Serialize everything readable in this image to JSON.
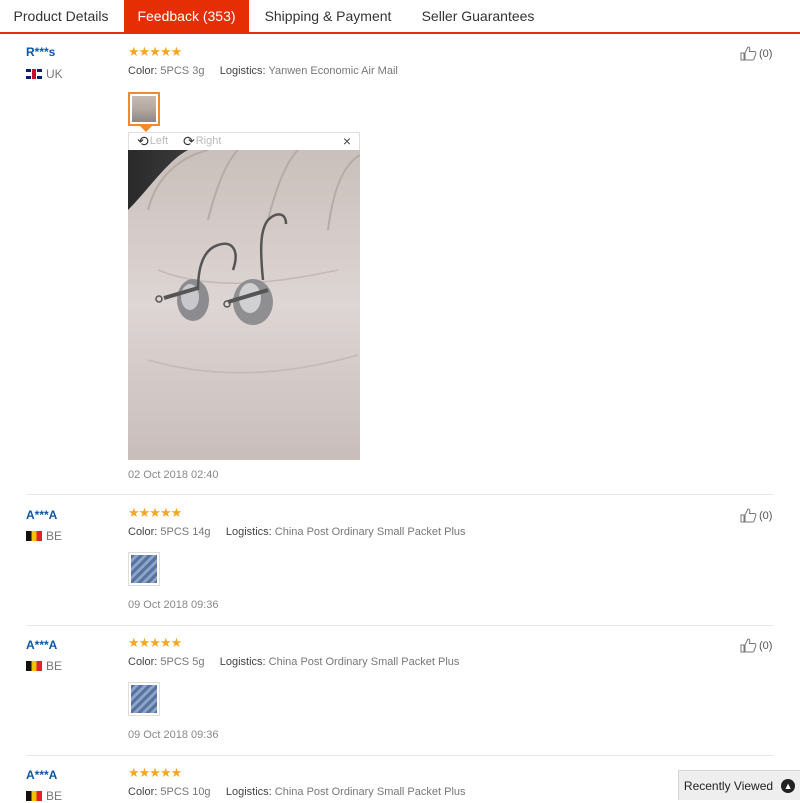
{
  "tabs": [
    {
      "label": "Product Details",
      "active": false
    },
    {
      "label": "Feedback (353)",
      "active": true
    },
    {
      "label": "Shipping & Payment",
      "active": false
    },
    {
      "label": "Seller Guarantees",
      "active": false
    }
  ],
  "reviews": [
    {
      "user": "R***s",
      "country": "UK",
      "flag": "uk-flag-icon",
      "rating": 5,
      "color_label": "Color:",
      "color_value": "5PCS 3g",
      "logistics_label": "Logistics:",
      "logistics_value": "Yanwen Economic Air Mail",
      "likes": "(0)",
      "date": "02 Oct 2018 02:40"
    },
    {
      "user": "A***A",
      "country": "BE",
      "flag": "be-flag-icon",
      "rating": 5,
      "color_label": "Color:",
      "color_value": "5PCS 14g",
      "logistics_label": "Logistics:",
      "logistics_value": "China Post Ordinary Small Packet Plus",
      "likes": "(0)",
      "date": "09 Oct 2018 09:36"
    },
    {
      "user": "A***A",
      "country": "BE",
      "flag": "be-flag-icon",
      "rating": 5,
      "color_label": "Color:",
      "color_value": "5PCS 5g",
      "logistics_label": "Logistics:",
      "logistics_value": "China Post Ordinary Small Packet Plus",
      "likes": "(0)",
      "date": "09 Oct 2018 09:36"
    },
    {
      "user": "A***A",
      "country": "BE",
      "flag": "be-flag-icon",
      "rating": 5,
      "color_label": "Color:",
      "color_value": "5PCS 10g",
      "logistics_label": "Logistics:",
      "logistics_value": "China Post Ordinary Small Packet Plus",
      "likes": "(0)",
      "date": ""
    }
  ],
  "viewer": {
    "rotate_left": "Left",
    "rotate_right": "Right",
    "close": "×"
  },
  "recently_viewed": {
    "label": "Recently Viewed"
  },
  "colors": {
    "accent": "#e62e04",
    "star": "#f5a623",
    "username": "#0b57a5"
  }
}
